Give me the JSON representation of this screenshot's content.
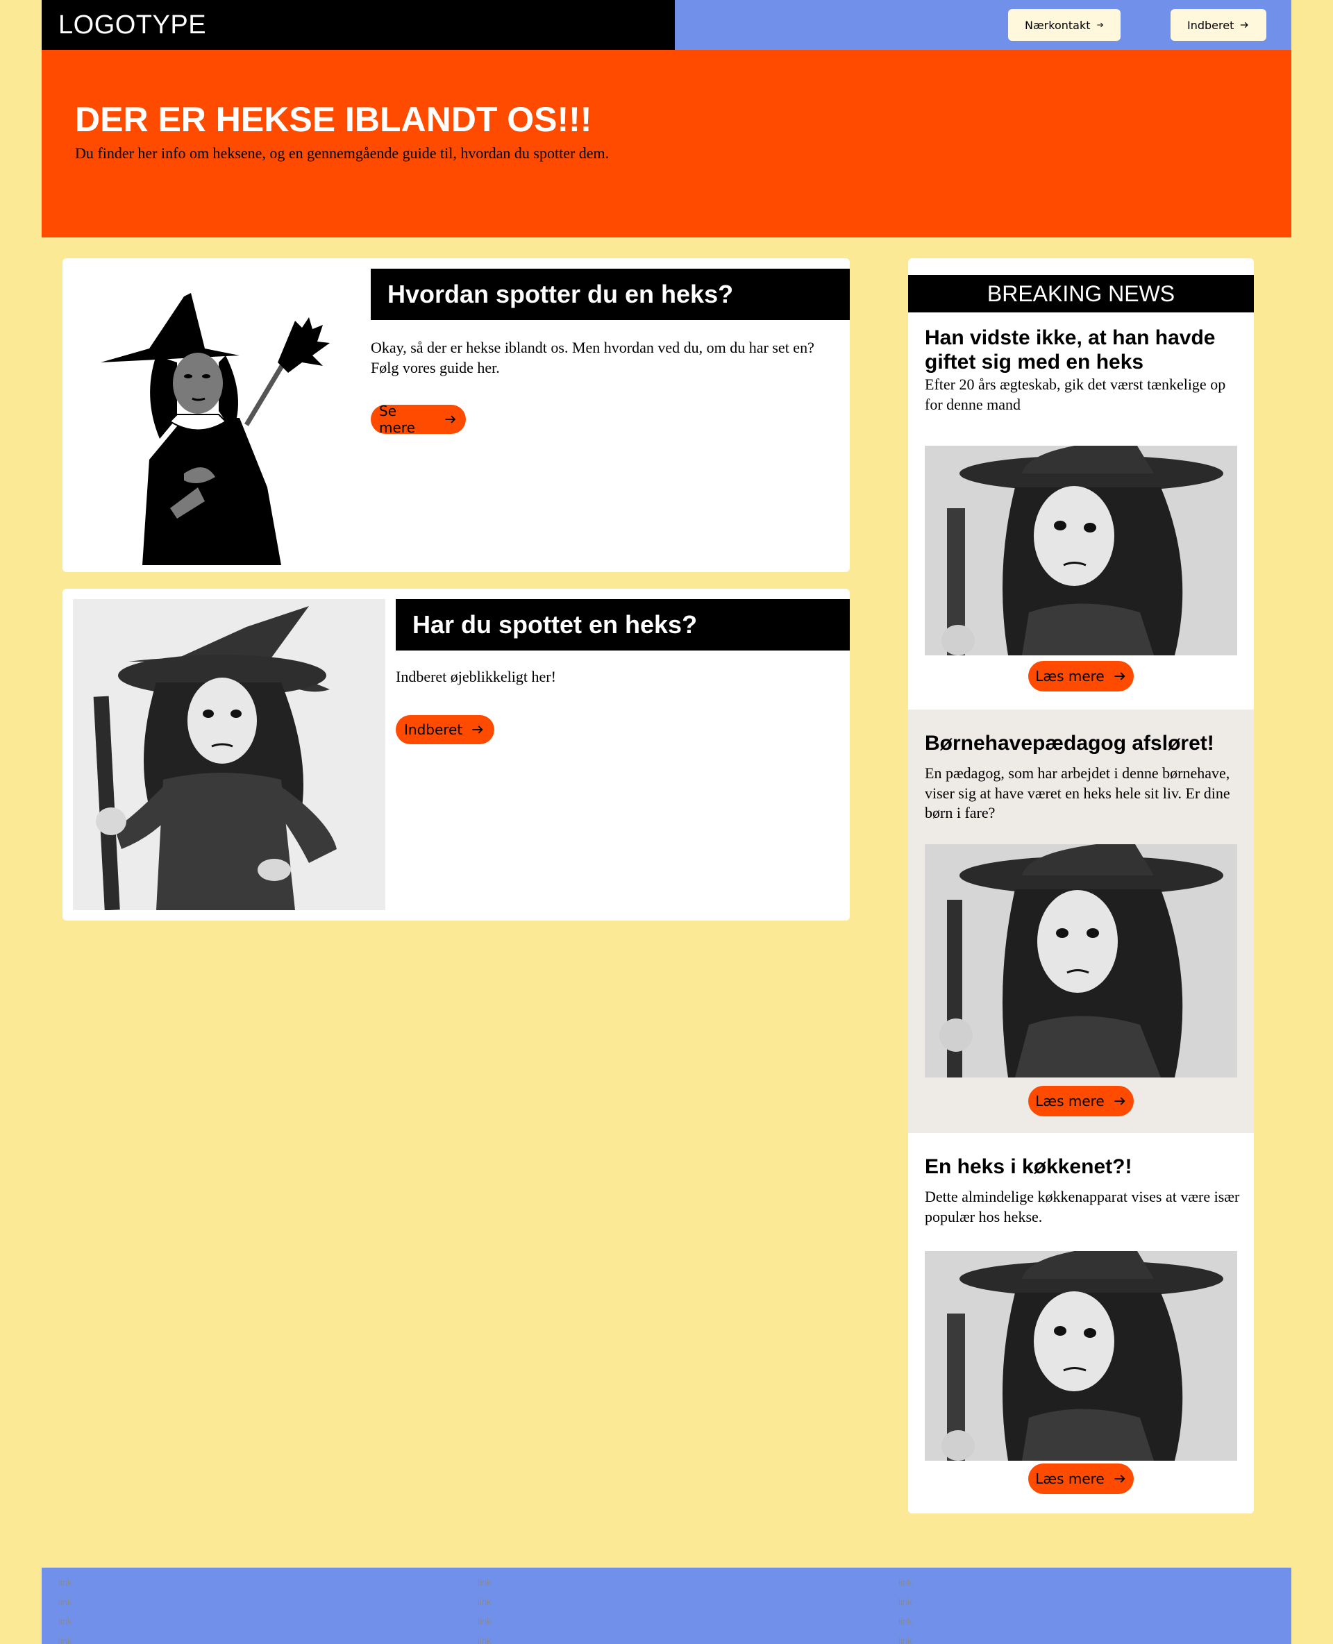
{
  "header": {
    "logo": "LOGOTYPE",
    "nav": [
      {
        "label": "Nærkontakt"
      },
      {
        "label": "Indberet"
      }
    ]
  },
  "hero": {
    "title": "DER ER HEKSE IBLANDT OS!!!",
    "subtitle": "Du finder her info om heksene, og en gennemgående guide til, hvordan du spotter dem."
  },
  "cards": [
    {
      "title": "Hvordan spotter du en heks?",
      "text": "Okay, så der er hekse iblandt os. Men hvordan ved du, om du har set en? Følg vores guide her.",
      "button": "Se mere"
    },
    {
      "title": "Har du spottet en heks?",
      "text": "Indberet øjeblikkeligt her!",
      "button": "Indberet"
    }
  ],
  "breaking_news": {
    "header": "BREAKING NEWS",
    "items": [
      {
        "title": "Han vidste ikke, at han havde giftet sig med en heks",
        "text": "Efter 20 års ægteskab, gik det værst tænkelige op for denne mand",
        "button": "Læs mere"
      },
      {
        "title": "Børnehavepædagog afsløret!",
        "text": "En pædagog, som har arbejdet i denne børnehave, viser sig at have været en heks hele sit liv. Er dine børn i fare?",
        "button": "Læs mere"
      },
      {
        "title": "En heks i køkkenet?!",
        "text": "Dette almindelige køkkenapparat vises at være især populær hos hekse.",
        "button": "Læs mere"
      }
    ]
  },
  "footer": {
    "columns": [
      [
        "link",
        "link",
        "link",
        "link"
      ],
      [
        "link",
        "link",
        "link",
        "link"
      ],
      [
        "link",
        "link",
        "link",
        "link"
      ]
    ]
  },
  "colors": {
    "background": "#fbe996",
    "accent": "#ff4b00",
    "nav_blue": "#7190ea",
    "black": "#000000",
    "button_cream": "#fff8dc"
  }
}
